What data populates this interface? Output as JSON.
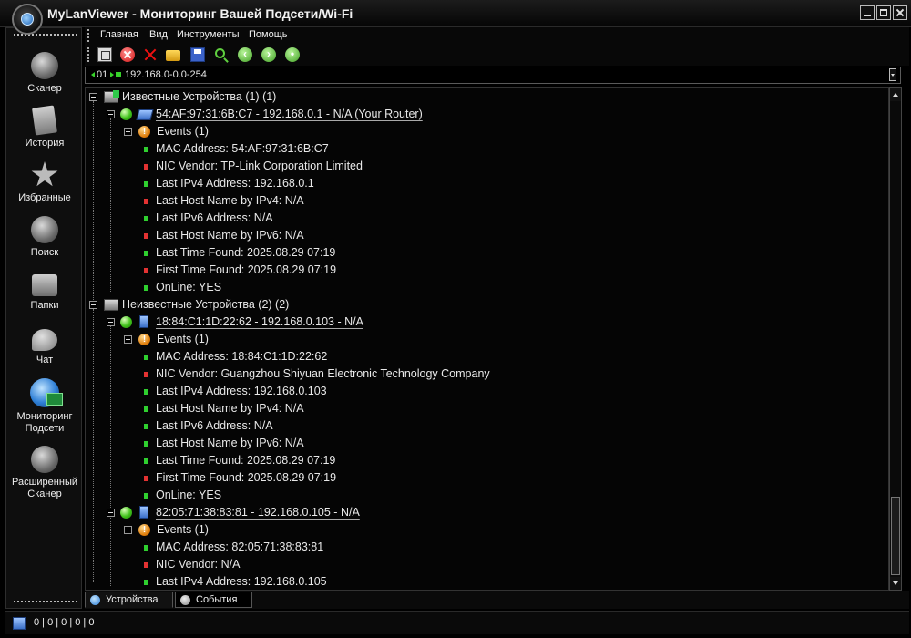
{
  "window": {
    "title": "MyLanViewer - Мониторинг Вашей Подсети/Wi-Fi"
  },
  "sidebar": {
    "items": [
      {
        "label": "Сканер",
        "icon": "scanner-icon"
      },
      {
        "label": "История",
        "icon": "history-icon"
      },
      {
        "label": "Избранные",
        "icon": "star-icon"
      },
      {
        "label": "Поиск",
        "icon": "search-icon"
      },
      {
        "label": "Папки",
        "icon": "folders-icon"
      },
      {
        "label": "Чат",
        "icon": "chat-icon"
      },
      {
        "label": "Мониторинг Подсети",
        "icon": "subnet-monitor-icon"
      },
      {
        "label": "Расширенный Сканер",
        "icon": "advanced-scanner-icon"
      }
    ]
  },
  "menu": {
    "items": [
      "Главная",
      "Вид",
      "Инструменты",
      "Помощь"
    ]
  },
  "toolbar": {
    "buttons": [
      "copy-icon",
      "stop-icon",
      "delete-icon",
      "open-folder-icon",
      "save-icon",
      "find-icon",
      "back-icon",
      "forward-icon",
      "refresh-icon"
    ]
  },
  "address": {
    "segment": "01",
    "range": "192.168.0-0.0-254"
  },
  "tree": {
    "known_group": "Известные Устройства (1) (1)",
    "unknown_group": "Неизвестные Устройства (2) (2)",
    "devices": [
      {
        "title": "54:AF:97:31:6B:C7 - 192.168.0.1 - N/A (Your Router)",
        "events": "Events (1)",
        "props": [
          "MAC Address: 54:AF:97:31:6B:C7",
          "NIC Vendor: TP-Link Corporation Limited",
          "Last IPv4 Address: 192.168.0.1",
          "Last Host Name by IPv4: N/A",
          "Last IPv6 Address: N/A",
          "Last Host Name by IPv6: N/A",
          "Last Time Found: 2025.08.29  07:19",
          "First Time Found: 2025.08.29  07:19",
          "OnLine: YES"
        ]
      },
      {
        "title": "18:84:C1:1D:22:62 - 192.168.0.103 - N/A",
        "events": "Events (1)",
        "props": [
          "MAC Address: 18:84:C1:1D:22:62",
          "NIC Vendor: Guangzhou Shiyuan Electronic Technology Company",
          "Last IPv4 Address: 192.168.0.103",
          "Last Host Name by IPv4: N/A",
          "Last IPv6 Address: N/A",
          "Last Host Name by IPv6: N/A",
          "Last Time Found: 2025.08.29  07:19",
          "First Time Found: 2025.08.29  07:19",
          "OnLine: YES"
        ]
      },
      {
        "title": "82:05:71:38:83:81 - 192.168.0.105 - N/A",
        "events": "Events (1)",
        "props": [
          "MAC Address: 82:05:71:38:83:81",
          "NIC Vendor: N/A",
          "Last IPv4 Address: 192.168.0.105"
        ]
      }
    ]
  },
  "tabs": {
    "devices": "Устройства",
    "events": "События"
  },
  "status": {
    "counters": "0  |  0  |  0  |  0  |  0"
  },
  "colors": {
    "ok_bullet": "#2fd02f",
    "bad_bullet": "#e33232",
    "online": "#3fc21a",
    "event": "#e07d0a"
  }
}
